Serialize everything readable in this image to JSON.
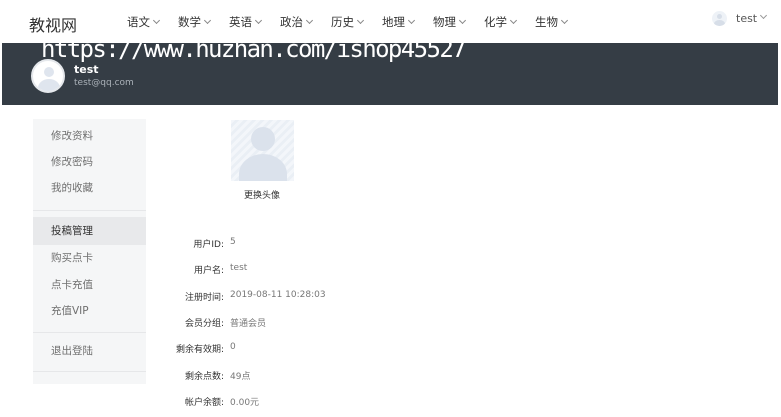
{
  "header": {
    "logo": "教视网",
    "nav": [
      "语文",
      "数学",
      "英语",
      "政治",
      "历史",
      "地理",
      "物理",
      "化学",
      "生物"
    ],
    "user": "test"
  },
  "watermark": "https://www.huzhan.com/ishop45527",
  "profile": {
    "name": "test",
    "email": "test@qq.com"
  },
  "sidebar": {
    "items": [
      "修改资料",
      "修改密码",
      "我的收藏",
      "投稿管理",
      "购买点卡",
      "点卡充值",
      "充值VIP",
      "退出登陆"
    ],
    "active": "投稿管理"
  },
  "avatar": {
    "change_label": "更换头像"
  },
  "info": [
    {
      "label": "用户ID:",
      "value": "5"
    },
    {
      "label": "用户名:",
      "value": "test"
    },
    {
      "label": "注册时间:",
      "value": "2019-08-11 10:28:03"
    },
    {
      "label": "会员分组:",
      "value": "普通会员"
    },
    {
      "label": "剩余有效期:",
      "value": "0"
    },
    {
      "label": "剩余点数:",
      "value": "49点"
    },
    {
      "label": "帐户余额:",
      "value": "0.00元"
    }
  ]
}
